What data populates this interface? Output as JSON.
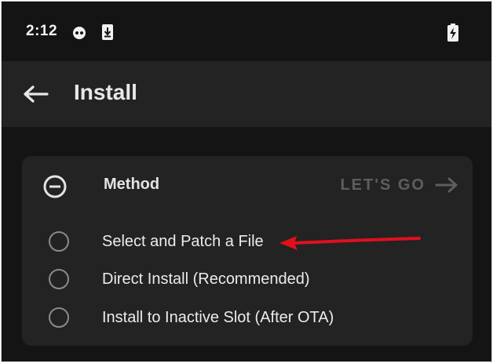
{
  "status_bar": {
    "time": "2:12",
    "icons": [
      "app-face-icon",
      "download-icon",
      "battery-charging-icon"
    ]
  },
  "app_bar": {
    "back_icon": "arrow-left-icon",
    "title": "Install"
  },
  "method_card": {
    "collapse_icon": "minus-circle-icon",
    "label": "Method",
    "action_label": "LET'S GO",
    "action_icon": "arrow-right-icon",
    "options": [
      {
        "label": "Select and Patch a File",
        "selected": false
      },
      {
        "label": "Direct Install (Recommended)",
        "selected": false
      },
      {
        "label": "Install to Inactive Slot (After OTA)",
        "selected": false
      }
    ]
  },
  "annotation": {
    "type": "arrow",
    "color": "#e0101c",
    "points_to": "Select and Patch a File"
  },
  "colors": {
    "background": "#141414",
    "surface": "#232323",
    "text": "#ececec",
    "muted": "#5e5e5e",
    "annotation": "#e0101c"
  }
}
